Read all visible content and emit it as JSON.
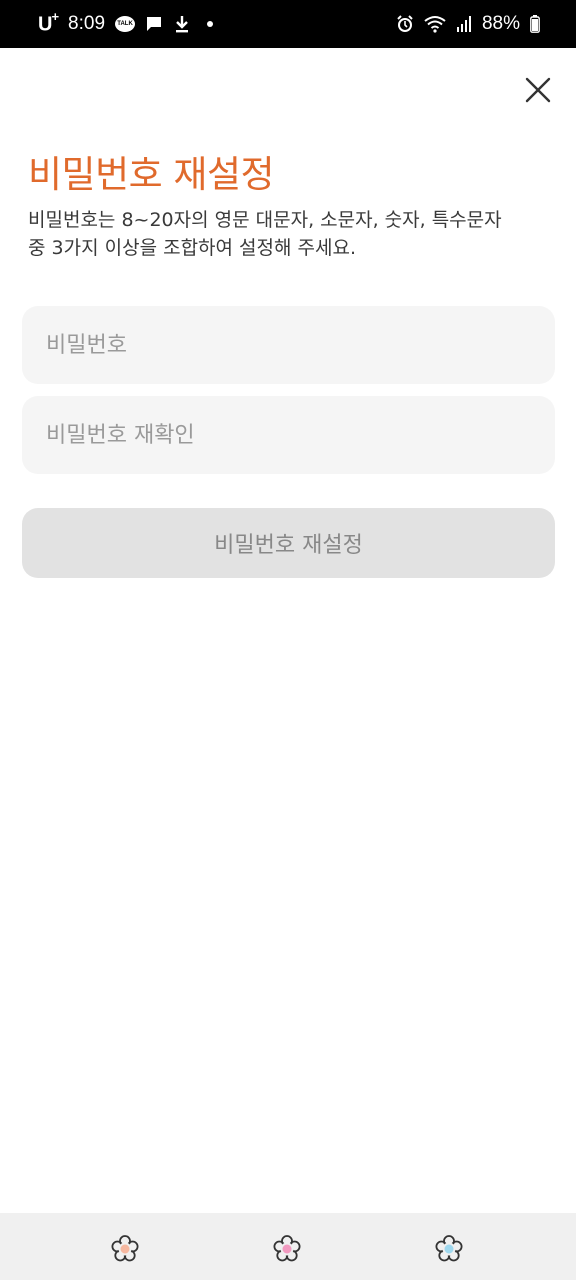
{
  "status_bar": {
    "carrier": "U",
    "carrier_sup": "+",
    "time": "8:09",
    "talk_badge": "TALK",
    "battery_percent": "88%",
    "icons": [
      "talk-icon",
      "message-icon",
      "download-icon",
      "dot-icon",
      "alarm-icon",
      "wifi-icon",
      "signal-icon",
      "battery-icon"
    ]
  },
  "header": {
    "close_icon": "close-icon"
  },
  "page": {
    "title": "비밀번호 재설정",
    "description_line1": "비밀번호는 8~20자의 영문 대문자, 소문자, 숫자, 특수문자",
    "description_line2": "중 3가지 이상을 조합하여 설정해 주세요."
  },
  "form": {
    "password_placeholder": "비밀번호",
    "password_value": "",
    "confirm_placeholder": "비밀번호 재확인",
    "confirm_value": "",
    "submit_label": "비밀번호 재설정"
  },
  "colors": {
    "accent": "#e06a2c",
    "input_bg": "#f5f5f5",
    "button_disabled_bg": "#e2e2e2",
    "nav_flower_1_center": "#f6b8a0",
    "nav_flower_2_center": "#f29ac0",
    "nav_flower_3_center": "#9fd8ee"
  },
  "nav_bar": {
    "buttons": [
      {
        "icon": "flower-icon"
      },
      {
        "icon": "flower-icon"
      },
      {
        "icon": "flower-icon"
      }
    ]
  }
}
